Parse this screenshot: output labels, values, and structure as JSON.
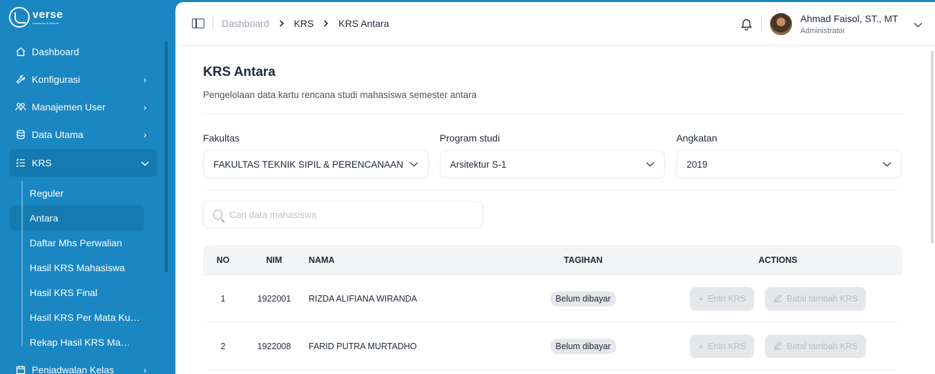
{
  "brand": {
    "word": "verse",
    "sub": "workspace & network",
    "logo_letters": "itn"
  },
  "sidebar": {
    "items": [
      {
        "label": "Dashboard",
        "icon": "home-icon"
      },
      {
        "label": "Konfigurasi",
        "icon": "wrench-icon"
      },
      {
        "label": "Manajemen User",
        "icon": "users-icon"
      },
      {
        "label": "Data Utama",
        "icon": "database-icon"
      },
      {
        "label": "KRS",
        "icon": "list-icon"
      }
    ],
    "krs_sub": [
      "Reguler",
      "Antara",
      "Daftar Mhs Perwalian",
      "Hasil KRS Mahasiswa",
      "Hasil KRS Final",
      "Hasil KRS Per Mata Kuliah",
      "Rekap Hasil KRS Mahasiswa"
    ],
    "after": {
      "label": "Penjadwalan Kelas",
      "icon": "calendar-icon"
    }
  },
  "breadcrumb": {
    "root": "Dashboard",
    "mid": "KRS",
    "current": "KRS Antara"
  },
  "user": {
    "name": "Ahmad Faisol, ST., MT",
    "role": "Administrator"
  },
  "page": {
    "title": "KRS Antara",
    "description": "Pengelolaan data kartu rencana studi mahasiswa semester antara"
  },
  "filters": {
    "fakultas": {
      "label": "Fakultas",
      "value": "FAKULTAS TEKNIK SIPIL & PERENCANAAN"
    },
    "prodi": {
      "label": "Program studi",
      "value": "Arsitektur S-1"
    },
    "angkatan": {
      "label": "Angkatan",
      "value": "2019"
    }
  },
  "search": {
    "placeholder": "Cari data mahasiswa",
    "value": ""
  },
  "table": {
    "headers": {
      "no": "NO",
      "nim": "NIM",
      "nama": "NAMA",
      "tagihan": "TAGIHAN",
      "actions": "ACTIONS"
    },
    "rows": [
      {
        "no": "1",
        "nim": "1922001",
        "nama": "RIZDA ALIFIANA WIRANDA",
        "tagihan": "Belum dibayar"
      },
      {
        "no": "2",
        "nim": "1922008",
        "nama": "FARID PUTRA MURTADHO",
        "tagihan": "Belum dibayar"
      }
    ],
    "actions": {
      "entri": "Entri KRS",
      "batal": "Batal tambah KRS"
    }
  }
}
